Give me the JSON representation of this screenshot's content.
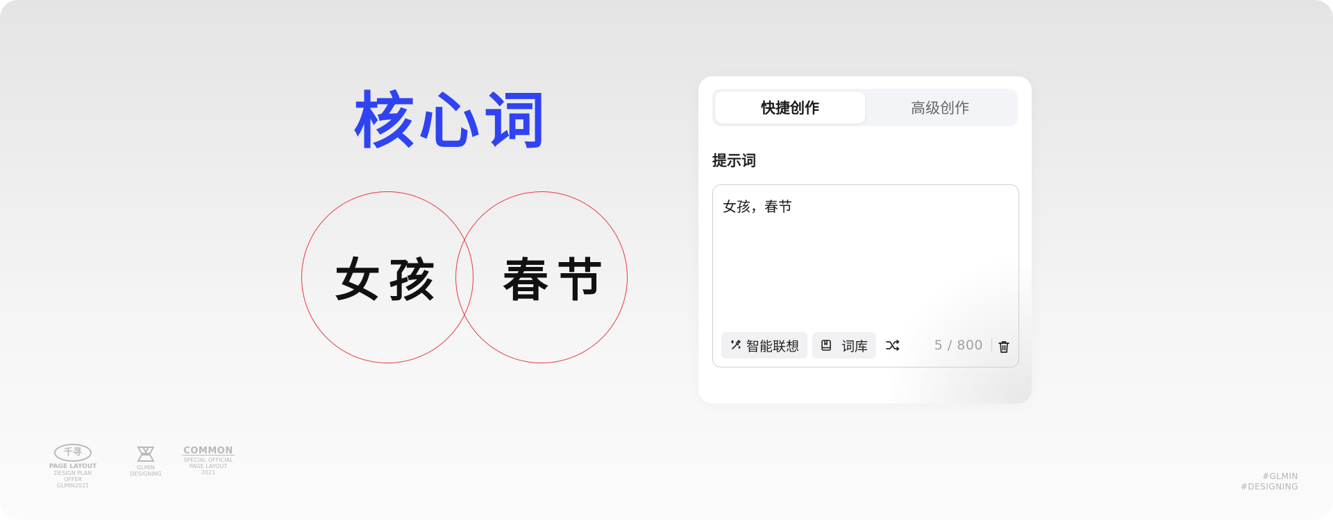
{
  "illustration": {
    "heading": "核心词",
    "circle_left_word": "女孩",
    "circle_right_word": "春节",
    "heading_color": "#2f43f2",
    "circle_color": "#e8363b"
  },
  "panel": {
    "tabs": [
      {
        "label": "快捷创作",
        "active": true
      },
      {
        "label": "高级创作",
        "active": false
      }
    ],
    "prompt_label": "提示词",
    "prompt_value": "女孩，春节",
    "actions": {
      "smart_associate_label": "智能联想",
      "smart_associate_icon": "magic-wand-icon",
      "library_label": "词库",
      "library_icon": "book-icon",
      "shuffle_icon": "shuffle-icon",
      "delete_icon": "trash-icon"
    },
    "counter": "5 / 800"
  },
  "footer": {
    "logos": [
      {
        "mark": "千寻",
        "title": "PAGE LAYOUT",
        "lines": [
          "DESIGN PLAN",
          "OFFER GLMIN2021"
        ]
      },
      {
        "title": "GLMIN",
        "lines": [
          "DESIGNING"
        ]
      },
      {
        "title": "COMMON",
        "lines": [
          "SPECIAL OFFICIAL",
          "PAGE LAYOUT",
          "2021"
        ]
      }
    ],
    "watermark": [
      "#GLMIN",
      "#DESIGNING"
    ]
  }
}
